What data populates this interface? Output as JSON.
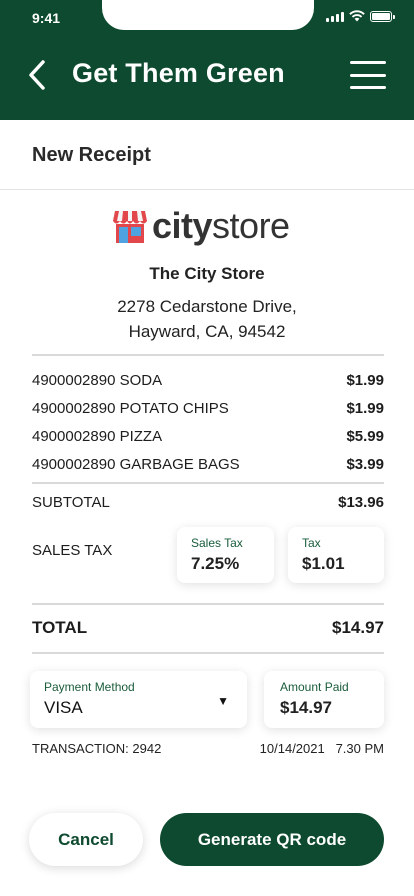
{
  "status_bar": {
    "time": "9:41"
  },
  "header": {
    "title": "Get Them Green",
    "back_icon": "chevron-left-icon",
    "menu_icon": "hamburger-menu-icon"
  },
  "page": {
    "title": "New Receipt"
  },
  "store": {
    "logo_bold": "city",
    "logo_light": "store",
    "name": "The City Store",
    "address_line1": "2278 Cedarstone Drive,",
    "address_line2": "Hayward, CA, 94542"
  },
  "items": [
    {
      "description": "4900002890 SODA",
      "price": "$1.99"
    },
    {
      "description": "4900002890 POTATO CHIPS",
      "price": "$1.99"
    },
    {
      "description": "4900002890 PIZZA",
      "price": "$5.99"
    },
    {
      "description": "4900002890 GARBAGE BAGS",
      "price": "$3.99"
    }
  ],
  "subtotal": {
    "label": "SUBTOTAL",
    "value": "$13.96"
  },
  "sales_tax": {
    "label": "SALES TAX",
    "rate_label": "Sales Tax",
    "rate_value": "7.25%",
    "amount_label": "Tax",
    "amount_value": "$1.01"
  },
  "total": {
    "label": "TOTAL",
    "value": "$14.97"
  },
  "payment": {
    "method_label": "Payment Method",
    "method_value": "VISA",
    "amount_label": "Amount Paid",
    "amount_value": "$14.97"
  },
  "transaction": {
    "label": "TRANSACTION: 2942",
    "date": "10/14/2021",
    "time": "7.30 PM"
  },
  "actions": {
    "cancel": "Cancel",
    "generate": "Generate QR code"
  },
  "colors": {
    "brand": "#0e4a2f",
    "accent_label": "#1a5c3b",
    "logo_red": "#e2474c",
    "logo_blue": "#4fa3e0"
  }
}
